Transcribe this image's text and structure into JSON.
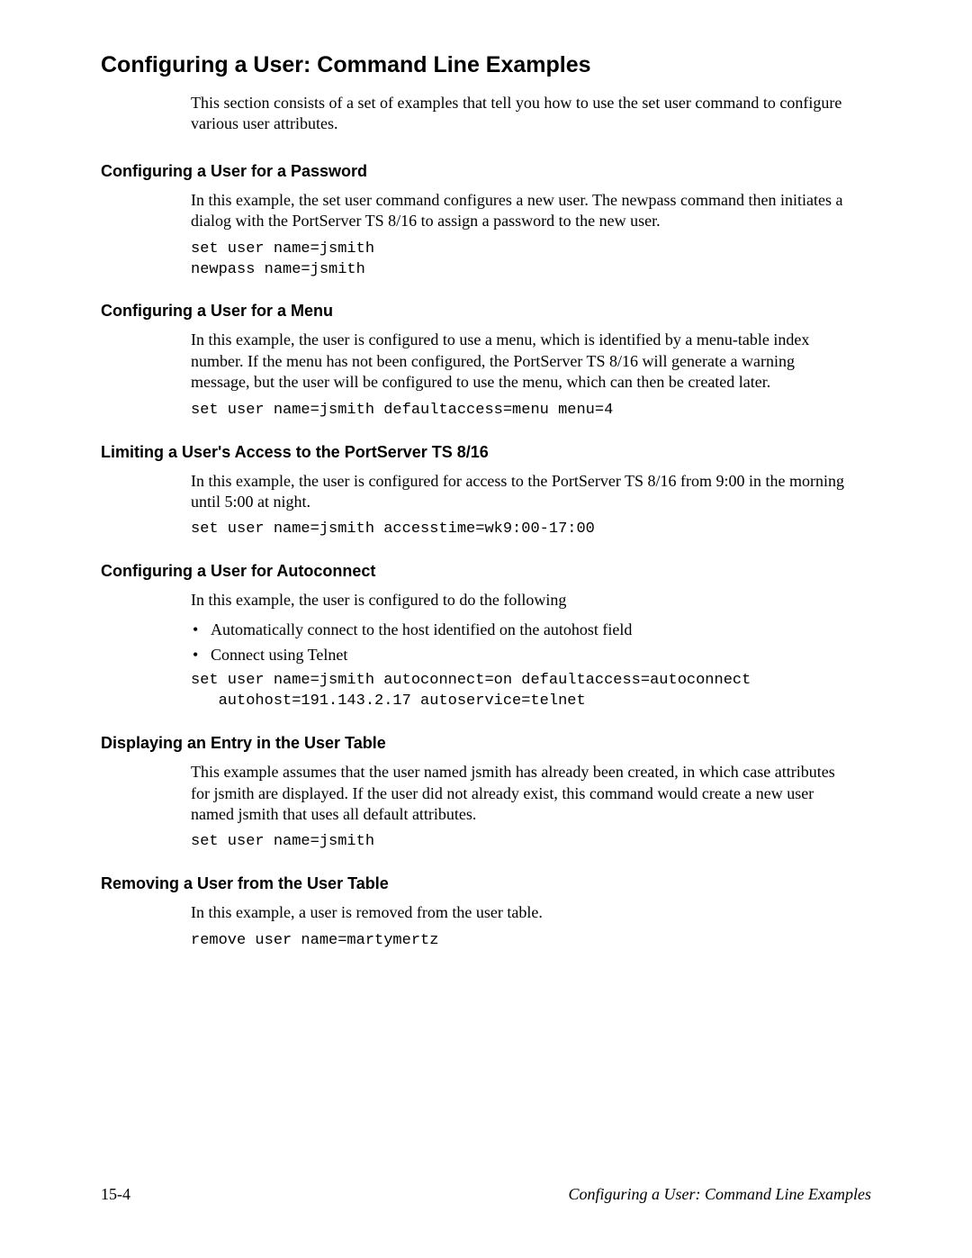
{
  "title": "Configuring a User: Command Line Examples",
  "intro": "This section consists of a set of examples that tell you how to use the set user command to configure various user attributes.",
  "sections": [
    {
      "heading": "Configuring a User for a Password",
      "text": "In this example, the set user command configures a new user. The newpass command then initiates a dialog with the PortServer TS 8/16 to assign a password to the new user.",
      "code": "set user name=jsmith\nnewpass name=jsmith"
    },
    {
      "heading": "Configuring a User for a Menu",
      "text": "In this example, the user is configured to use a menu, which is identified by a menu-table index number. If the menu has not been configured, the PortServer TS 8/16 will generate a warning message, but the user will be configured to use the menu, which can then be created later.",
      "code": "set user name=jsmith defaultaccess=menu menu=4"
    },
    {
      "heading": "Limiting a User's Access to the PortServer TS 8/16",
      "text": "In this example, the user is configured for access to the PortServer TS 8/16 from 9:00 in the morning until 5:00 at night.",
      "code": "set user name=jsmith accesstime=wk9:00-17:00"
    },
    {
      "heading": "Configuring a User for Autoconnect",
      "text": "In this example, the user is configured to do the following",
      "bullets": [
        "Automatically connect to the host identified on the autohost field",
        "Connect using Telnet"
      ],
      "code": "set user name=jsmith autoconnect=on defaultaccess=autoconnect\n   autohost=191.143.2.17 autoservice=telnet"
    },
    {
      "heading": "Displaying an Entry in the User Table",
      "text": "This example assumes that the user named jsmith has already been created, in which case attributes for jsmith are displayed. If the user did not already exist, this command would create a new user named jsmith that uses all default attributes.",
      "code": "set user name=jsmith"
    },
    {
      "heading": "Removing a User from the User Table",
      "text": "In this example, a user is removed from the user table.",
      "code": "remove user name=martymertz"
    }
  ],
  "footer": {
    "left": "15-4",
    "right": "Configuring a User: Command Line Examples"
  }
}
